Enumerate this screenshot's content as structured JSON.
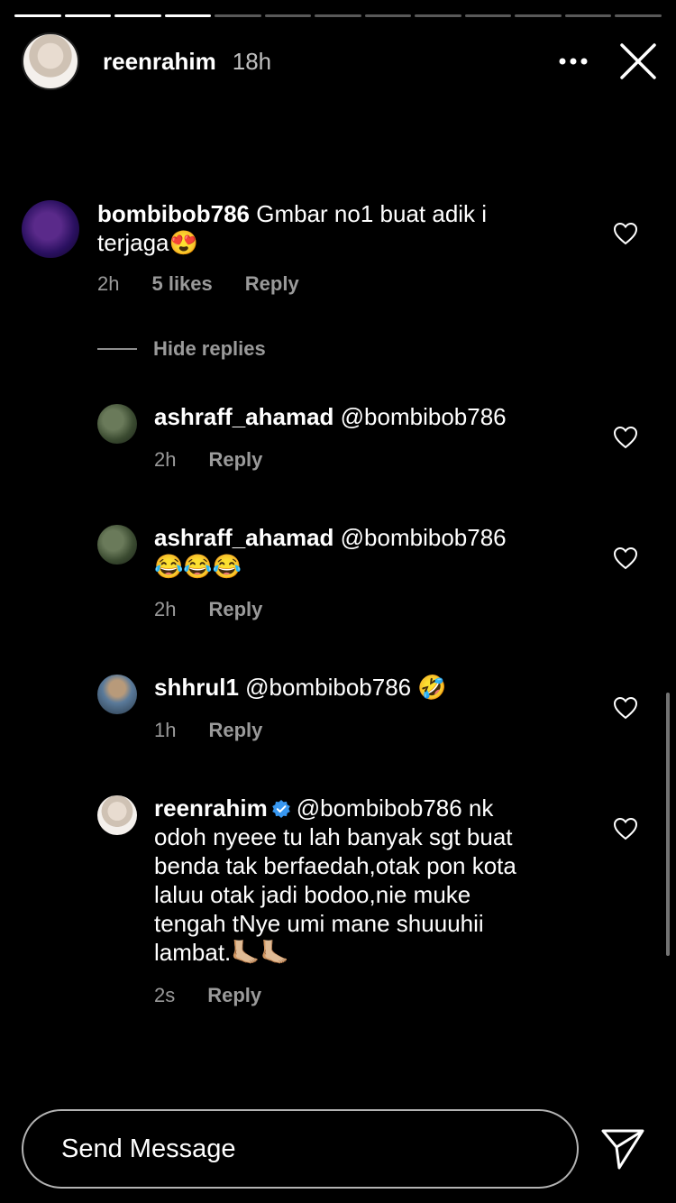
{
  "story": {
    "username": "reenrahim",
    "time": "18h",
    "progress_total": 13,
    "progress_done": 4
  },
  "icons": {
    "more": "more-horizontal-icon",
    "close": "close-icon",
    "heart": "heart-outline-icon",
    "send": "send-icon",
    "verified": "verified-badge-icon"
  },
  "comments": [
    {
      "username": "bombibob786",
      "text": "Gmbar no1 buat adik i",
      "text2": "terjaga😍",
      "time": "2h",
      "likes": "5 likes",
      "reply": "Reply"
    }
  ],
  "hide_replies": "Hide replies",
  "replies": [
    {
      "username": "ashraff_ahamad",
      "text": "@bombibob786",
      "time": "2h",
      "reply": "Reply"
    },
    {
      "username": "ashraff_ahamad",
      "text": "@bombibob786",
      "text2": "😂😂😂",
      "time": "2h",
      "reply": "Reply"
    },
    {
      "username": "shhrul1",
      "text": "@bombibob786 🤣",
      "time": "1h",
      "reply": "Reply"
    },
    {
      "username": "reenrahim",
      "text": "@bombibob786 nk",
      "lines": [
        "odoh nyeee tu lah banyak sgt buat",
        "benda tak berfaedah,otak pon kota",
        "laluu otak jadi bodoo,nie muke",
        "tengah tNye umi mane shuuuhii",
        "lambat.🦶🏼🦶🏼"
      ],
      "time": "2s",
      "reply": "Reply"
    }
  ],
  "footer": {
    "placeholder": "Send Message"
  },
  "colors": {
    "background": "#000000",
    "muted": "#9a9a9a",
    "verified": "#3897f0"
  }
}
